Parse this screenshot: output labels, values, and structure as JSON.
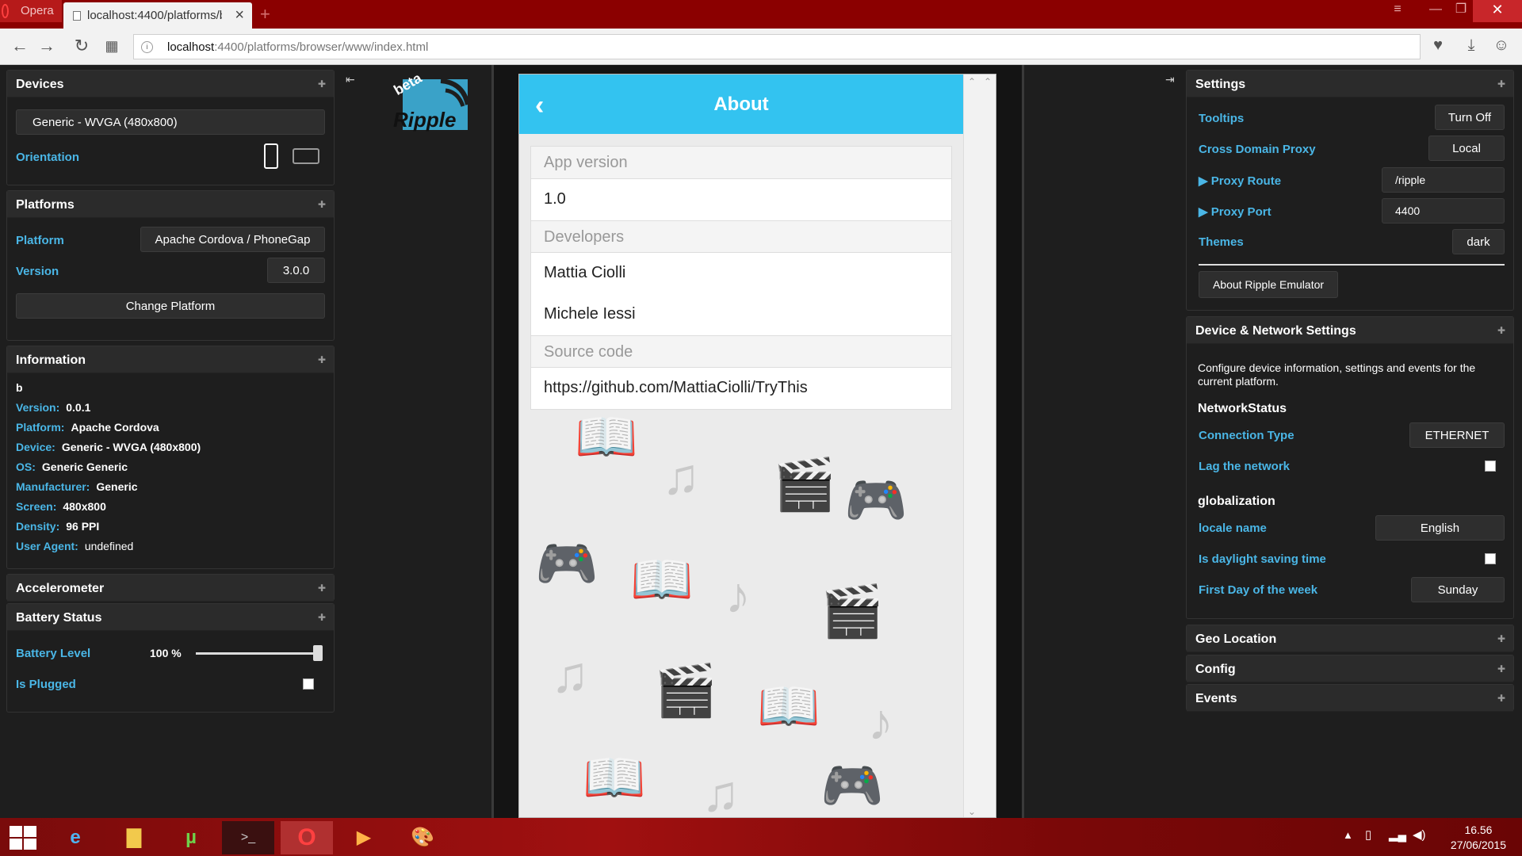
{
  "browser": {
    "menu_label": "Opera",
    "tab_title": "localhost:4400/platforms/b",
    "new_tab": "+",
    "url_host": "localhost",
    "url_rest": ":4400/platforms/browser/www/index.html"
  },
  "left": {
    "devices": {
      "title": "Devices",
      "device": "Generic - WVGA (480x800)",
      "orientation_label": "Orientation"
    },
    "platforms": {
      "title": "Platforms",
      "platform_label": "Platform",
      "platform_value": "Apache Cordova / PhoneGap",
      "version_label": "Version",
      "version_value": "3.0.0",
      "change_button": "Change Platform"
    },
    "information": {
      "title": "Information",
      "app_name": "b",
      "lines": [
        {
          "k": "Version:",
          "v": "0.0.1"
        },
        {
          "k": "Platform:",
          "v": "Apache Cordova"
        },
        {
          "k": "Device:",
          "v": "Generic - WVGA (480x800)"
        },
        {
          "k": "OS:",
          "v": "Generic Generic"
        },
        {
          "k": "Manufacturer:",
          "v": "Generic"
        },
        {
          "k": "Screen:",
          "v": "480x800"
        },
        {
          "k": "Density:",
          "v": "96 PPI"
        },
        {
          "k": "User Agent:",
          "v": "undefined"
        }
      ]
    },
    "accelerometer": {
      "title": "Accelerometer"
    },
    "battery": {
      "title": "Battery Status",
      "level_label": "Battery Level",
      "level_value": "100 %",
      "level_fraction": 1.0,
      "plugged_label": "Is Plugged"
    }
  },
  "phone": {
    "title": "About",
    "sections": [
      {
        "head": "App version",
        "items": [
          "1.0"
        ]
      },
      {
        "head": "Developers",
        "items": [
          "Mattia Ciolli",
          "Michele Iessi"
        ]
      },
      {
        "head": "Source code",
        "items": [
          "https://github.com/MattiaCiolli/TryThis"
        ]
      }
    ]
  },
  "logo": {
    "beta": "beta",
    "name": "Ripple"
  },
  "right": {
    "settings": {
      "title": "Settings",
      "tooltips_label": "Tooltips",
      "tooltips_btn": "Turn Off",
      "proxy_label": "Cross Domain Proxy",
      "proxy_value": "Local",
      "route_label": "▶ Proxy Route",
      "route_value": "/ripple",
      "port_label": "▶ Proxy Port",
      "port_value": "4400",
      "themes_label": "Themes",
      "themes_value": "dark",
      "about_btn": "About Ripple Emulator"
    },
    "device_network": {
      "title": "Device & Network Settings",
      "desc": "Configure device information, settings and events for the current platform.",
      "network_heading": "NetworkStatus",
      "conn_label": "Connection Type",
      "conn_value": "ETHERNET",
      "lag_label": "Lag the network",
      "glob_heading": "globalization",
      "locale_label": "locale name",
      "locale_value": "English",
      "dst_label": "Is daylight saving time",
      "firstday_label": "First Day of the week",
      "firstday_value": "Sunday"
    },
    "geo": {
      "title": "Geo Location"
    },
    "config": {
      "title": "Config"
    },
    "events": {
      "title": "Events"
    }
  },
  "taskbar": {
    "time": "16.56",
    "date": "27/06/2015"
  }
}
